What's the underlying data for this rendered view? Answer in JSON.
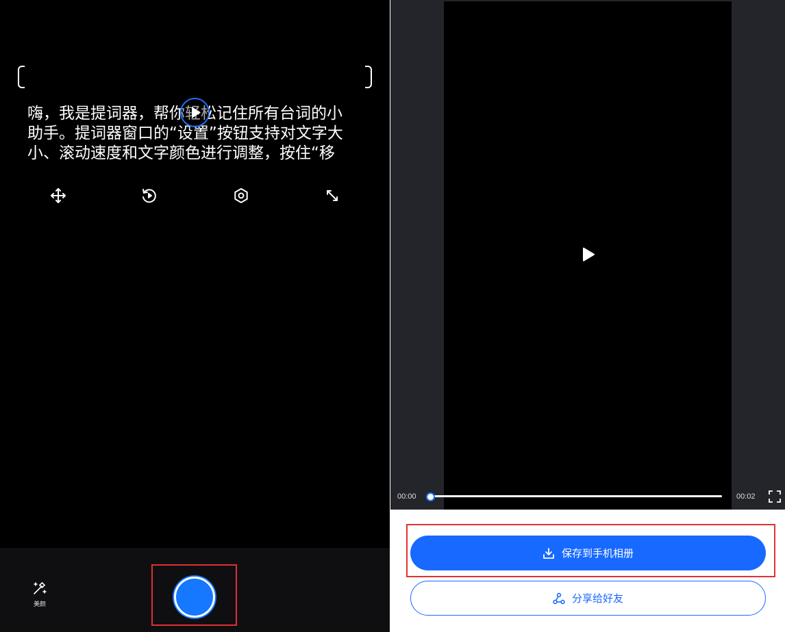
{
  "teleprompter": {
    "text_lines": [
      "嗨，我是提词器，帮你轻松记住所有台词的小",
      "助手。提词器窗口的“设置”按钮支持对文字大",
      "小、滚动速度和文字颜色进行调整，按住“移"
    ],
    "icons": [
      "move-icon",
      "reset-icon",
      "settings-icon",
      "resize-icon"
    ]
  },
  "bottom_bar": {
    "beauty_label": "美颜"
  },
  "video": {
    "current_time": "00:00",
    "duration": "00:02",
    "progress": 0
  },
  "actions": {
    "save_label": "保存到手机相册",
    "share_label": "分享给好友"
  },
  "colors": {
    "accent": "#1769ff",
    "highlight_outline": "#e03131"
  }
}
